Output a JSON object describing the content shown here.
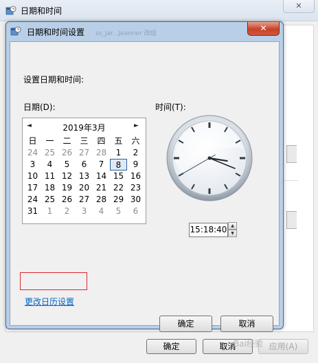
{
  "outer_window": {
    "title": "日期和时间",
    "close_label": "✕",
    "buttons": {
      "ok": "确定",
      "cancel": "取消",
      "apply": "应用(A)"
    }
  },
  "dialog": {
    "title": "日期和时间设置",
    "ghost_text": "ss_Jar...Jeanner 改组",
    "close_label": "✕",
    "heading": "设置日期和时间:",
    "date_label": "日期(D):",
    "time_label": "时间(T):",
    "change_calendar_link": "更改日历设置",
    "ok_label": "确定",
    "cancel_label": "取消"
  },
  "calendar": {
    "month_title": "2019年3月",
    "prev_arrow": "◄",
    "next_arrow": "►",
    "weekdays": [
      "日",
      "一",
      "二",
      "三",
      "四",
      "五",
      "六"
    ],
    "weeks": [
      [
        "24",
        "25",
        "26",
        "27",
        "28",
        "1",
        "2"
      ],
      [
        "3",
        "4",
        "5",
        "6",
        "7",
        "8",
        "9"
      ],
      [
        "10",
        "11",
        "12",
        "13",
        "14",
        "15",
        "16"
      ],
      [
        "17",
        "18",
        "19",
        "20",
        "21",
        "22",
        "23"
      ],
      [
        "24",
        "25",
        "26",
        "27",
        "28",
        "29",
        "30"
      ],
      [
        "31",
        "1",
        "2",
        "3",
        "4",
        "5",
        "6"
      ]
    ],
    "selected_day": "8"
  },
  "clock": {
    "time_text": "15:18:40",
    "hours": 15,
    "minutes": 18,
    "seconds": 40
  },
  "colors": {
    "dialog_frame": "#b8cfe7",
    "close_button": "#c7432a",
    "link": "#0066cc",
    "annotation": "#e0262a"
  },
  "watermark": "Bai经验"
}
